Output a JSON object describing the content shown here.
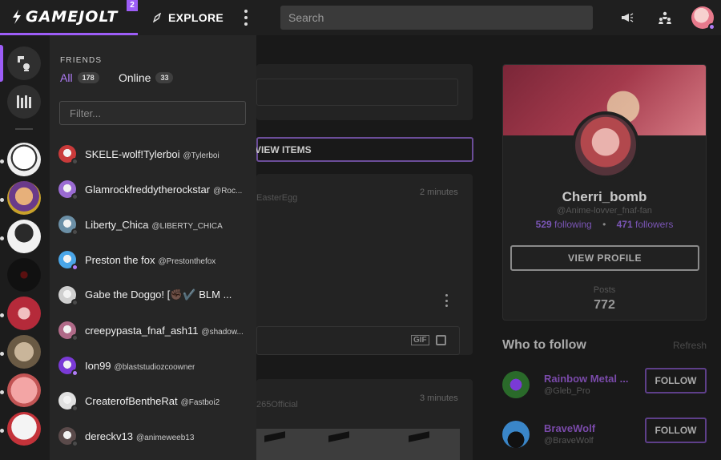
{
  "topbar": {
    "logo_text": "GAMEJOLT",
    "notif_count": "2",
    "explore_label": "EXPLORE",
    "search_placeholder": "Search"
  },
  "rail": {
    "items": [
      "home",
      "library",
      "friend-1",
      "friend-2",
      "friend-3",
      "friend-4",
      "friend-5",
      "friend-6",
      "friend-7",
      "friend-8"
    ]
  },
  "friends": {
    "section_label": "FRIENDS",
    "tabs": [
      {
        "label": "All",
        "count": "178"
      },
      {
        "label": "Online",
        "count": "33"
      }
    ],
    "filter_placeholder": "Filter...",
    "list": [
      {
        "name": "SKELE-wolf!Tylerboi",
        "handle": "@Tylerboi",
        "online": false,
        "color": "#c93a3a"
      },
      {
        "name": "Glamrockfreddytherockstar",
        "handle": "@Roc...",
        "online": false,
        "color": "#9a6bd2"
      },
      {
        "name": "Liberty_Chica",
        "handle": "@LIBERTY_CHICA",
        "online": false,
        "color": "#6b8fa6"
      },
      {
        "name": "Preston the fox",
        "handle": "@Prestonthefox",
        "online": true,
        "color": "#4aa6e8"
      },
      {
        "name": "Gabe the Doggo! [✊🏿✔️ BLM ...",
        "handle": "",
        "online": false,
        "color": "#cfcfcf"
      },
      {
        "name": "creepypasta_fnaf_ash11",
        "handle": "@shadow...",
        "online": false,
        "color": "#b06a88"
      },
      {
        "name": "Ion99",
        "handle": "@blaststudiozcoowner",
        "online": true,
        "color": "#7a3ad6"
      },
      {
        "name": "CreaterofBentheRat",
        "handle": "@Fastboi2",
        "online": false,
        "color": "#e0e0e0"
      },
      {
        "name": "dereckv13",
        "handle": "@animeweeb13",
        "online": false,
        "color": "#5a4a4a"
      }
    ]
  },
  "feed": {
    "view_items": "VIEW ITEMS",
    "post1_time": "2 minutes",
    "post1_handle": "EasterEgg",
    "post2_time": "3 minutes",
    "post2_handle": "265Official",
    "gif_label": "GIF"
  },
  "profile": {
    "name": "Cherri_bomb",
    "handle": "@Anime-lovver_fnaf-fan",
    "following_count": "529",
    "following_label": "following",
    "followers_count": "471",
    "followers_label": "followers",
    "view_profile": "VIEW PROFILE",
    "posts_label": "Posts",
    "posts_count": "772"
  },
  "who_to_follow": {
    "title": "Who to follow",
    "refresh": "Refresh",
    "follow_label": "FOLLOW",
    "users": [
      {
        "name": "Rainbow Metal ...",
        "handle": "@Gleb_Pro"
      },
      {
        "name": "BraveWolf",
        "handle": "@BraveWolf"
      }
    ]
  },
  "colors": {
    "accent": "#9d5df7",
    "panel": "#262626",
    "topbar": "#1f1f1f"
  }
}
